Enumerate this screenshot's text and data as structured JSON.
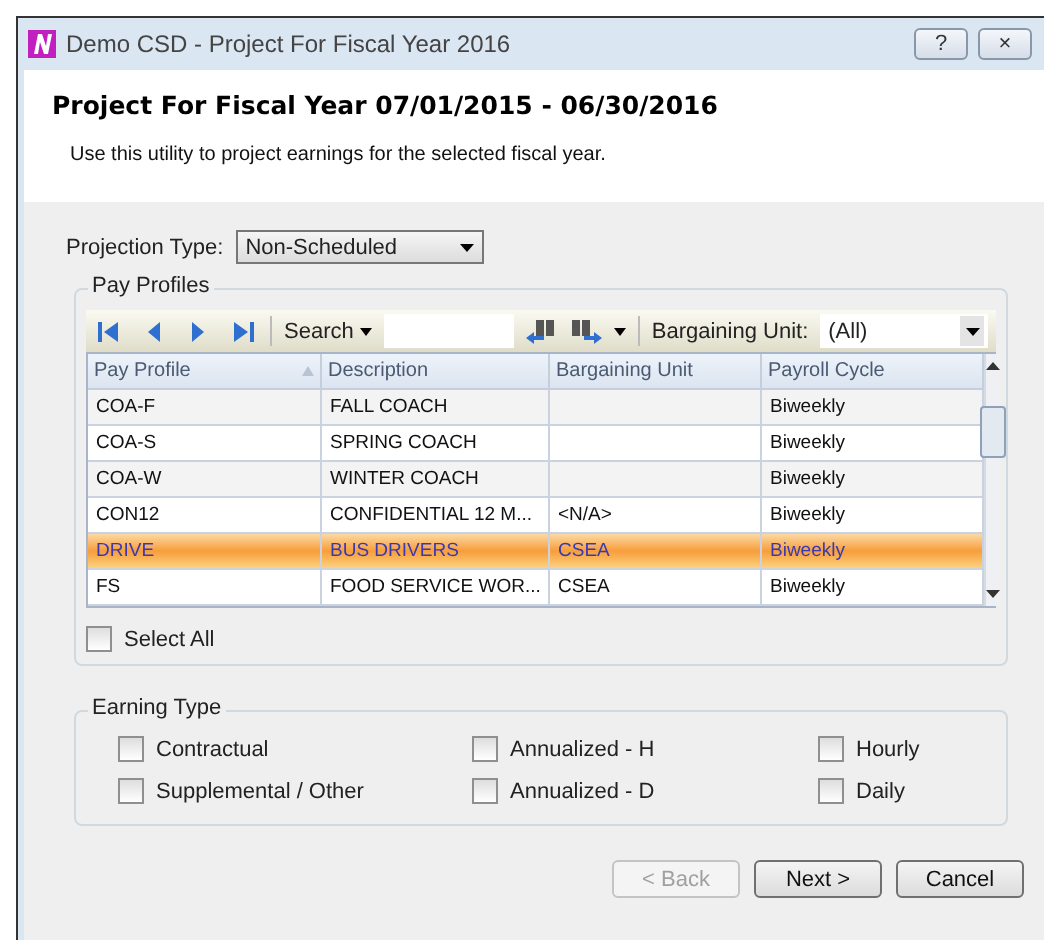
{
  "window": {
    "title": "Demo CSD - Project For Fiscal Year 2016",
    "buttons": [
      "?",
      "×"
    ]
  },
  "header": {
    "title": "Project For Fiscal Year 07/01/2015 - 06/30/2016",
    "description": "Use this utility to project earnings for the selected fiscal year."
  },
  "projection_type": {
    "label": "Projection Type:",
    "value": "Non-Scheduled"
  },
  "pay_profiles": {
    "title": "Pay Profiles",
    "toolbar": {
      "search_label": "Search",
      "bargaining_unit_label": "Bargaining Unit:",
      "bargaining_unit_value": "(All)"
    },
    "columns": [
      "Pay Profile",
      "Description",
      "Bargaining Unit",
      "Payroll Cycle"
    ],
    "rows": [
      {
        "cells": [
          "COA-F",
          "FALL COACH",
          "",
          "Biweekly"
        ],
        "selected": false
      },
      {
        "cells": [
          "COA-S",
          "SPRING COACH",
          "",
          "Biweekly"
        ],
        "selected": false
      },
      {
        "cells": [
          "COA-W",
          "WINTER COACH",
          "",
          "Biweekly"
        ],
        "selected": false
      },
      {
        "cells": [
          "CON12",
          "CONFIDENTIAL 12 M...",
          "<N/A>",
          "Biweekly"
        ],
        "selected": false
      },
      {
        "cells": [
          "DRIVE",
          "BUS DRIVERS",
          "CSEA",
          "Biweekly"
        ],
        "selected": true
      },
      {
        "cells": [
          "FS",
          "FOOD SERVICE WOR...",
          "CSEA",
          "Biweekly"
        ],
        "selected": false
      }
    ],
    "select_all": {
      "label": "Select All",
      "checked": false
    }
  },
  "earning_type": {
    "title": "Earning Type",
    "options": [
      {
        "label": "Contractual",
        "checked": false
      },
      {
        "label": "Annualized - H",
        "checked": false
      },
      {
        "label": "Hourly",
        "checked": false
      },
      {
        "label": "Supplemental / Other",
        "checked": false
      },
      {
        "label": "Annualized - D",
        "checked": false
      },
      {
        "label": "Daily",
        "checked": false
      }
    ]
  },
  "buttons": [
    {
      "label": "< Back",
      "disabled": true
    },
    {
      "label": "Next >",
      "disabled": false
    },
    {
      "label": "Cancel",
      "disabled": false
    }
  ]
}
